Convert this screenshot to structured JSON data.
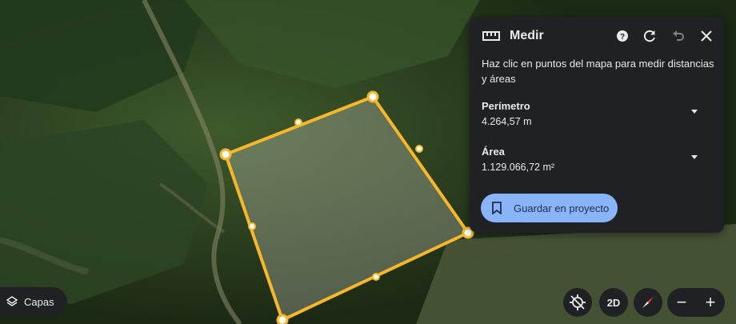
{
  "panel": {
    "title": "Medir",
    "hint": "Haz clic en puntos del mapa para medir distancias y áreas",
    "perimetro": {
      "label": "Perímetro",
      "value": "4.264,57 m"
    },
    "area": {
      "label": "Área",
      "value": "1.129.066,72 m²"
    },
    "save_label": "Guardar en proyecto",
    "icons": [
      "ruler-icon",
      "help-icon",
      "refresh-icon",
      "undo-icon",
      "close-icon",
      "chevron-down-icon",
      "bookmark-icon"
    ]
  },
  "bottom_left": {
    "layers_label": "Capas"
  },
  "bottom_right": {
    "view_2d_label": "2D",
    "zoom_out": "−",
    "zoom_in": "+"
  },
  "colors": {
    "panel_bg": "#202124",
    "accent": "#8ab4f8",
    "polygon_stroke": "#f6b72a",
    "text": "#e8eaed"
  }
}
